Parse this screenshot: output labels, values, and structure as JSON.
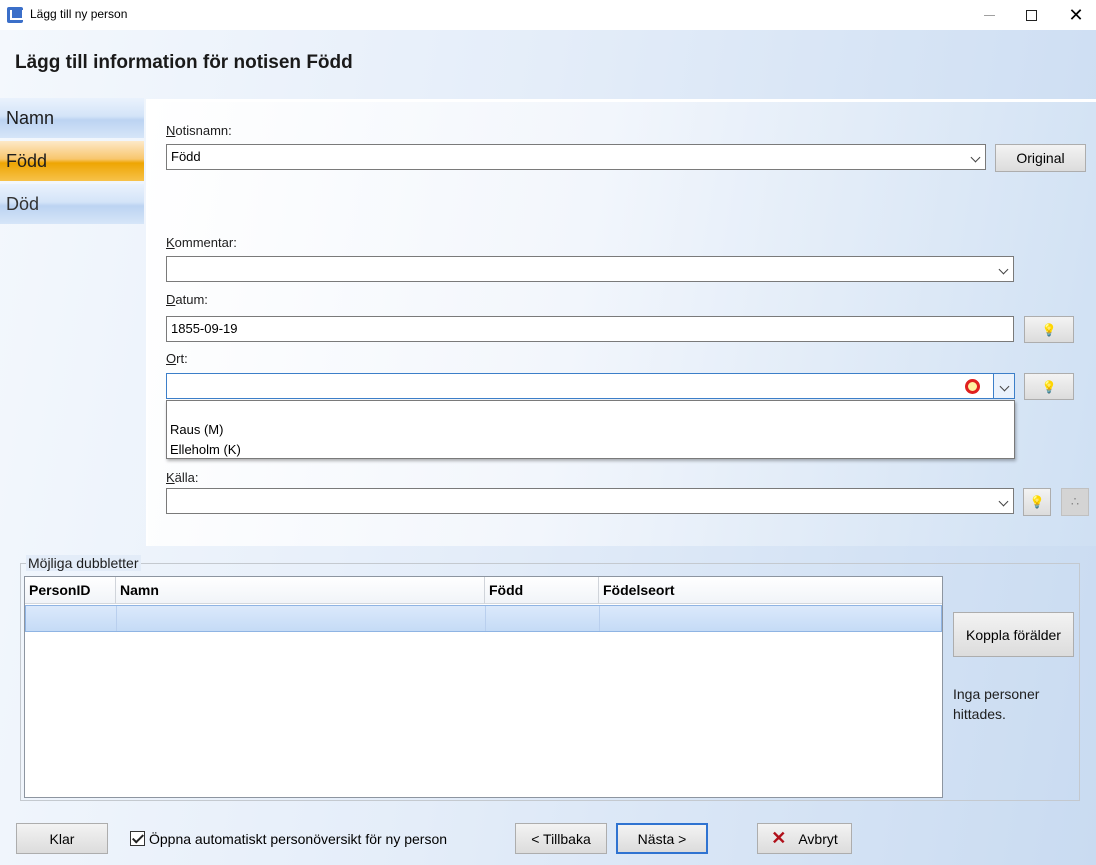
{
  "window": {
    "title": "Lägg till ny person"
  },
  "header": {
    "title": "Lägg till information för notisen Född"
  },
  "nav": {
    "items": [
      {
        "label": "Namn",
        "state": "normal"
      },
      {
        "label": "Född",
        "state": "selected"
      },
      {
        "label": "Död",
        "state": "normal"
      }
    ]
  },
  "form": {
    "notisnamn": {
      "label_u": "N",
      "label_rest": "otisnamn:",
      "value": "Född"
    },
    "original_button": "Original",
    "kommentar": {
      "label_u": "K",
      "label_rest": "ommentar:",
      "value": ""
    },
    "datum": {
      "label_u": "D",
      "label_rest": "atum:",
      "value": "1855-09-19"
    },
    "ort": {
      "label_u": "O",
      "label_rest": "rt:",
      "value": "",
      "options": [
        "Raus (M)",
        "Elleholm (K)"
      ]
    },
    "kalla": {
      "label_u": "K",
      "label_rest": "älla:",
      "value": ""
    },
    "bulb_glyph": "💡"
  },
  "duplicates": {
    "legend": "Möjliga dubbletter",
    "columns": [
      "PersonID",
      "Namn",
      "Född",
      "Födelseort"
    ],
    "link_parent_button": "Koppla förälder",
    "no_persons_text": "Inga personer hittades."
  },
  "footer": {
    "done_button": "Klar",
    "auto_open_label": "Öppna automatiskt personöversikt för ny person",
    "auto_open_checked": true,
    "back_button": "< Tillbaka",
    "next_button": "Nästa >",
    "cancel_button": "Avbryt"
  },
  "colors": {
    "selected_nav": "#eea502",
    "focus_border": "#3c7fc9",
    "cancel_icon": "#b0101a"
  }
}
